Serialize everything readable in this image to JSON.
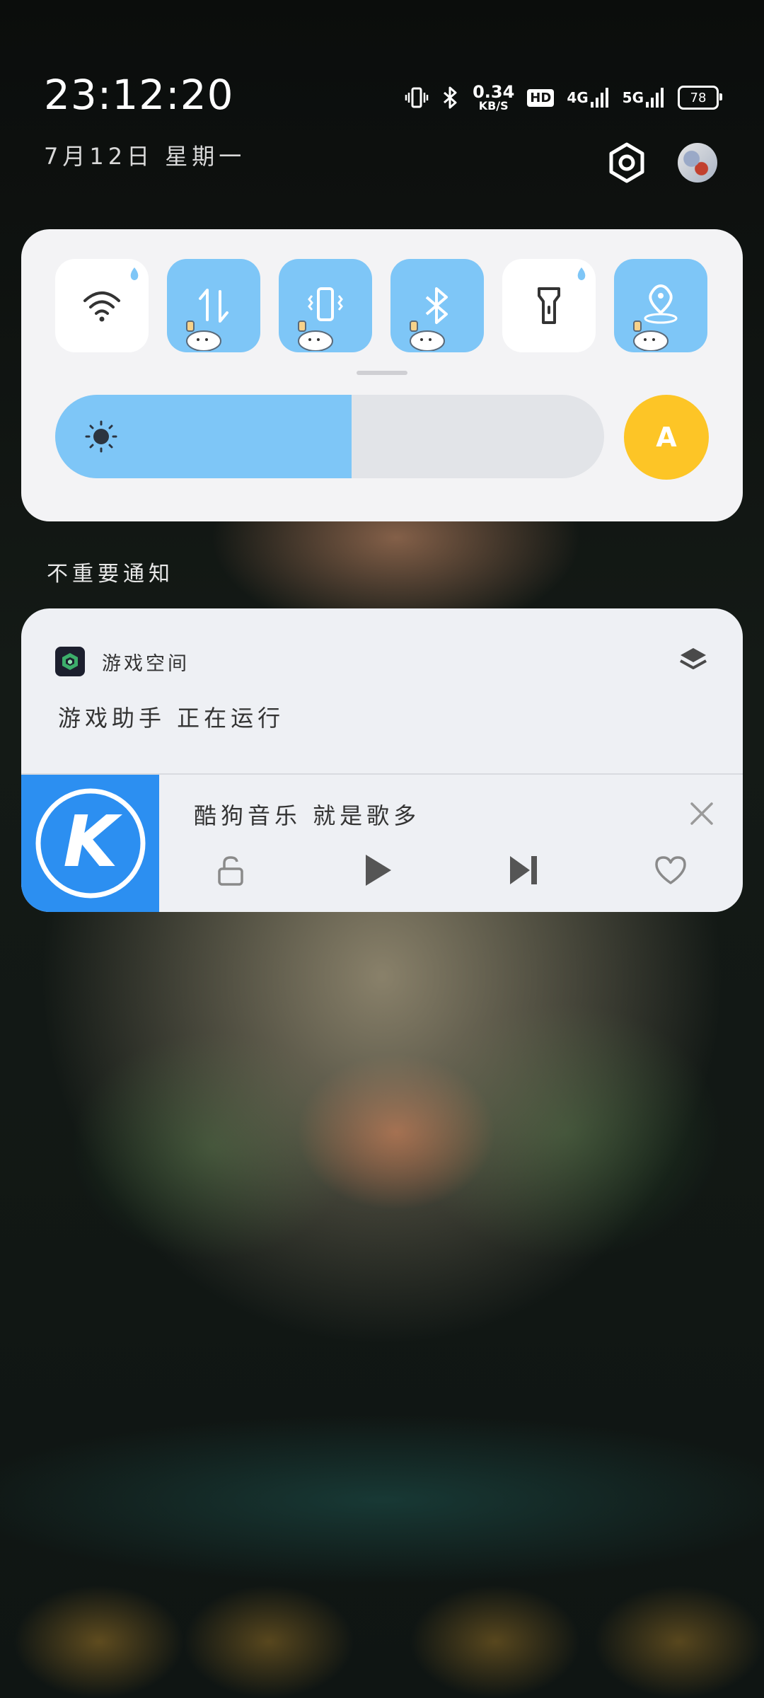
{
  "status_bar": {
    "time": "23:12:20",
    "date": "7月12日  星期一",
    "net_speed_value": "0.34",
    "net_speed_unit": "KB/S",
    "hd_label": "HD",
    "sim1_network": "4G",
    "sim2_network": "5G",
    "battery": "78"
  },
  "quick_settings": {
    "tiles": [
      {
        "name": "wifi",
        "icon": "wifi-icon",
        "active": false
      },
      {
        "name": "mobile-data",
        "icon": "data-arrows-icon",
        "active": true
      },
      {
        "name": "vibrate",
        "icon": "vibrate-icon",
        "active": true
      },
      {
        "name": "bluetooth",
        "icon": "bluetooth-icon",
        "active": true
      },
      {
        "name": "flashlight",
        "icon": "flashlight-icon",
        "active": false
      },
      {
        "name": "location",
        "icon": "location-icon",
        "active": true
      }
    ],
    "brightness_level": 0.54,
    "auto_brightness_label": "A"
  },
  "notifications": {
    "section_title": "不重要通知",
    "game_card": {
      "app_name": "游戏空间",
      "message": "游戏助手 正在运行"
    },
    "music_card": {
      "title": "酷狗音乐 就是歌多",
      "cover_letter": "K"
    }
  },
  "colors": {
    "accent_blue": "#7ec6f7",
    "auto_yellow": "#fdc526",
    "kugou_blue": "#2c8ff1"
  }
}
